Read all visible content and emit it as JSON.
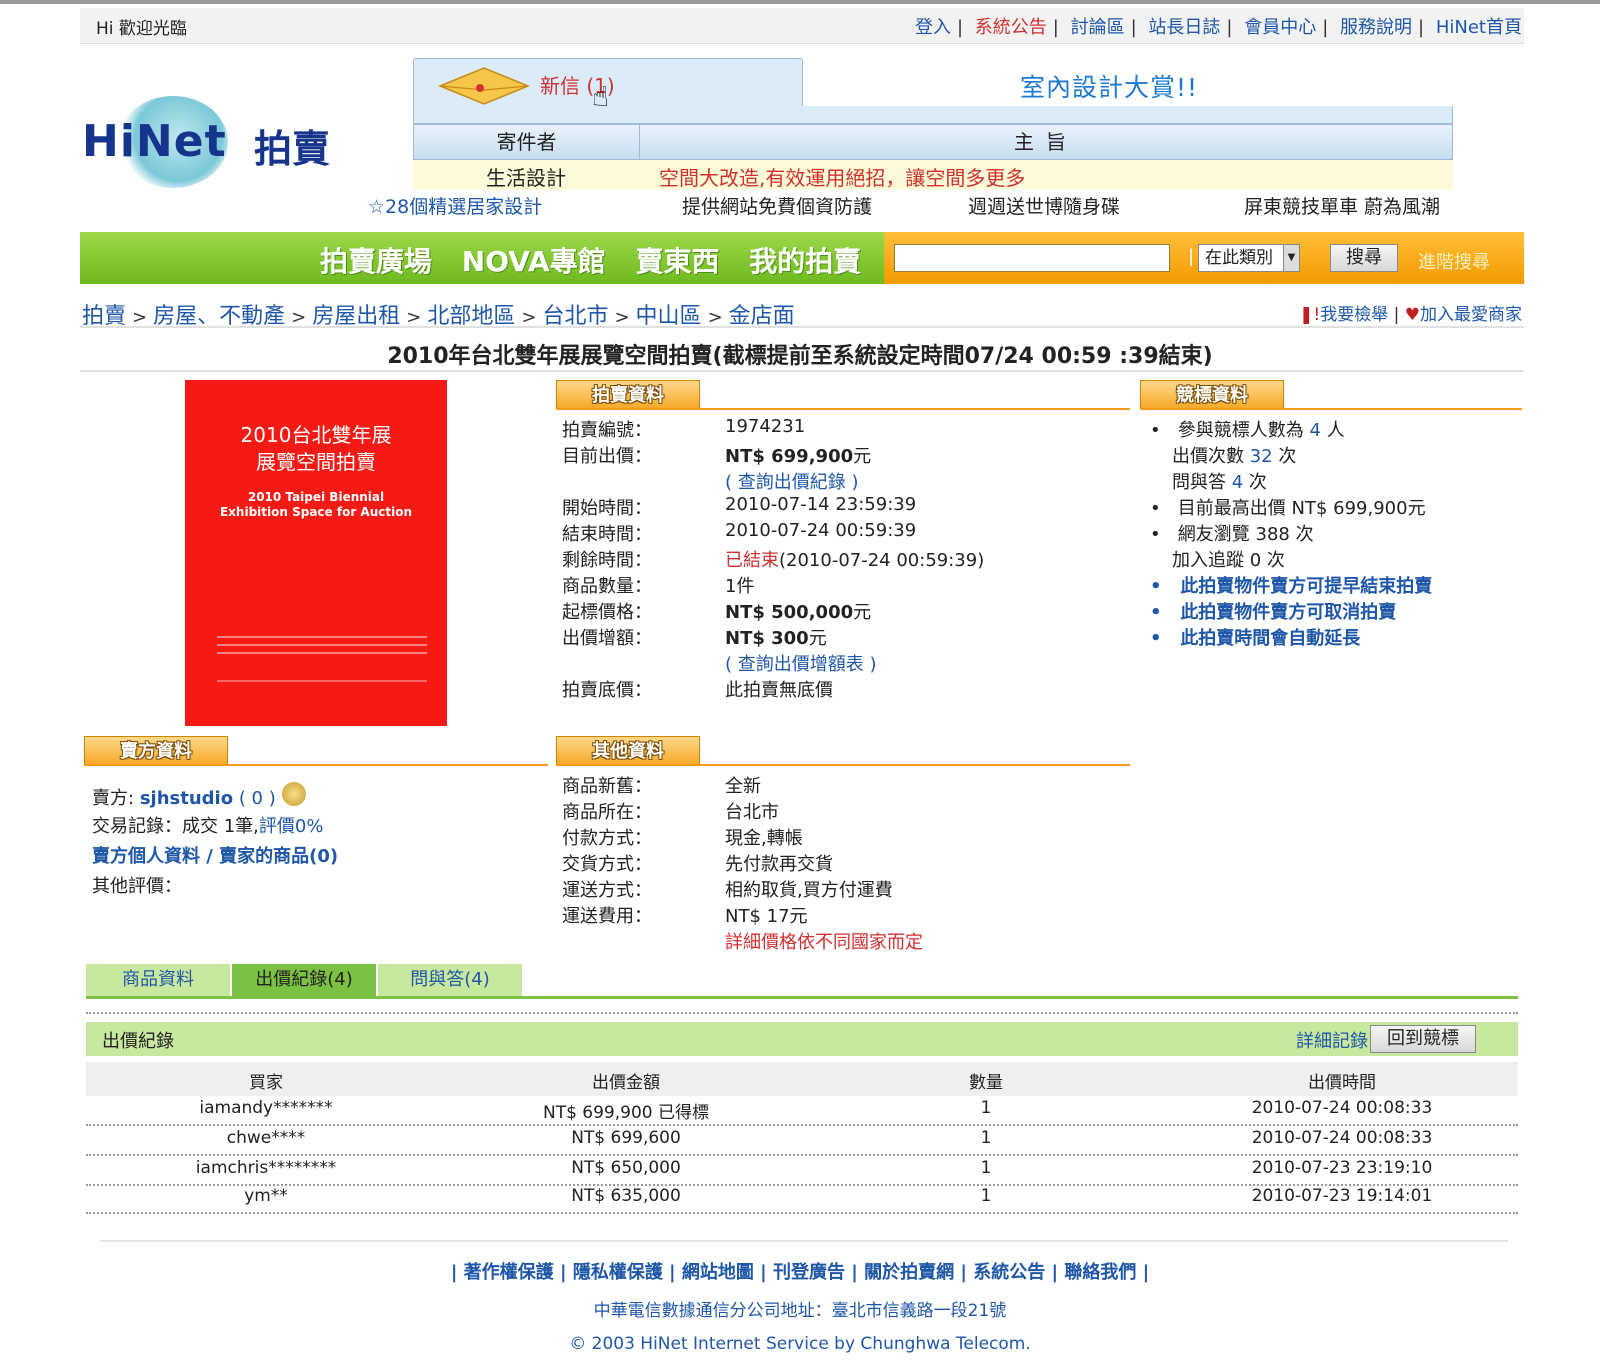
{
  "header": {
    "welcome": "Hi 歡迎光臨",
    "links": [
      "登入",
      "系統公告",
      "討論區",
      "站長日誌",
      "會員中心",
      "服務說明",
      "HiNet首頁"
    ]
  },
  "logo": {
    "word_a": "Hi",
    "word_b": "Net",
    "cjk": "拍賣"
  },
  "mail": {
    "new_label": "新信",
    "new_count": "(1)",
    "promo": "室內設計大賞!!",
    "col_sender": "寄件者",
    "col_subject": "主旨",
    "sender": "生活設計",
    "subject": "空間大改造,有效運用絕招，讓空間多更多"
  },
  "hotlinks": [
    "☆28個精選居家設計",
    "提供網站免費個資防護",
    "週週送世博隨身碟",
    "屏東競技單車 蔚為風潮"
  ],
  "nav": {
    "items": [
      "拍賣廣場",
      "NOVA專館",
      "賣東西",
      "我的拍賣"
    ],
    "search_category": "在此類別",
    "search_button": "搜尋",
    "advanced": "進階搜尋"
  },
  "breadcrumb": [
    "拍賣",
    "房屋、不動產",
    "房屋出租",
    "北部地區",
    "台北市",
    "中山區",
    "金店面"
  ],
  "actions": {
    "report": "我要檢舉",
    "favorite": "加入最愛商家"
  },
  "title": "2010年台北雙年展展覽空間拍賣(截標提前至系統設定時間07/24 00:59 :39結束)",
  "image": {
    "cn1": "2010台北雙年展",
    "cn2": "展覽空間拍賣",
    "en1": "2010 Taipei Biennial",
    "en2": "Exhibition Space for Auction"
  },
  "auction": {
    "heading": "拍賣資料",
    "id_k": "拍賣編號：",
    "id_v": "1974231",
    "price_k": "目前出價：",
    "price_v": "NT$ 699,900",
    "price_unit": "元",
    "price_link": "( 查詢出價紀錄 )",
    "start_k": "開始時間：",
    "start_v": "2010-07-14 23:59:39",
    "end_k": "結束時間：",
    "end_v": "2010-07-24 00:59:39",
    "remain_k": "剩餘時間：",
    "remain_status": "已結束",
    "remain_v": "(2010-07-24 00:59:39)",
    "qty_k": "商品數量：",
    "qty_v": "1件",
    "open_k": "起標價格：",
    "open_v": "NT$ 500,000",
    "open_unit": "元",
    "inc_k": "出價增額：",
    "inc_v": "NT$ 300",
    "inc_unit": "元",
    "inc_link": "( 查詢出價增額表 )",
    "reserve_k": "拍賣底價：",
    "reserve_v": "此拍賣無底價"
  },
  "bidinfo": {
    "heading": "競標資料",
    "bidders_a": "參與競標人數為",
    "bidders_n": "4",
    "bidders_u": "人",
    "bids_a": "出價次數",
    "bids_n": "32",
    "bids_u": "次",
    "qa_a": "問與答",
    "qa_n": "4",
    "qa_u": "次",
    "highest": "目前最高出價 NT$ 699,900元",
    "views": "網友瀏覽 388 次",
    "tracking": "加入追蹤 0 次",
    "note1": "此拍賣物件賣方可提早結束拍賣",
    "note2": "此拍賣物件賣方可取消拍賣",
    "note3": "此拍賣時間會自動延長"
  },
  "seller": {
    "heading": "賣方資料",
    "label": "賣方:",
    "name": "sjhstudio",
    "score": "( 0 )",
    "record_a": "交易記錄：成交 1筆,",
    "record_b": "評價0%",
    "profile": "賣方個人資料 / 賣家的商品(0)",
    "other": "其他評價："
  },
  "other": {
    "heading": "其他資料",
    "cond_k": "商品新舊：",
    "cond_v": "全新",
    "loc_k": "商品所在：",
    "loc_v": "台北市",
    "pay_k": "付款方式：",
    "pay_v": "現金,轉帳",
    "deliv_k": "交貨方式：",
    "deliv_v": "先付款再交貨",
    "ship_k": "運送方式：",
    "ship_v": "相約取貨,買方付運費",
    "fee_k": "運送費用：",
    "fee_v": "NT$ 17元",
    "fee_note": "詳細價格依不同國家而定"
  },
  "tabs": [
    "商品資料",
    "出價紀錄(4)",
    "問與答(4)"
  ],
  "bids": {
    "label": "出價紀錄",
    "detail": "詳細記錄",
    "back": "回到競標",
    "cols": [
      "買家",
      "出價金額",
      "數量",
      "出價時間"
    ],
    "rows": [
      [
        "iamandy*******",
        "NT$ 699,900 已得標",
        "1",
        "2010-07-24 00:08:33"
      ],
      [
        "chwe****",
        "NT$ 699,600",
        "1",
        "2010-07-24 00:08:33"
      ],
      [
        "iamchris********",
        "NT$ 650,000",
        "1",
        "2010-07-23 23:19:10"
      ],
      [
        "ym**",
        "NT$ 635,000",
        "1",
        "2010-07-23 19:14:01"
      ]
    ]
  },
  "footer": {
    "links": [
      "著作權保護",
      "隱私權保護",
      "網站地圖",
      "刊登廣告",
      "關於拍賣網",
      "系統公告",
      "聯絡我們"
    ],
    "address": "中華電信數據通信分公司地址：臺北市信義路一段21號",
    "copyright": "© 2003 HiNet Internet Service by Chunghwa Telecom."
  }
}
